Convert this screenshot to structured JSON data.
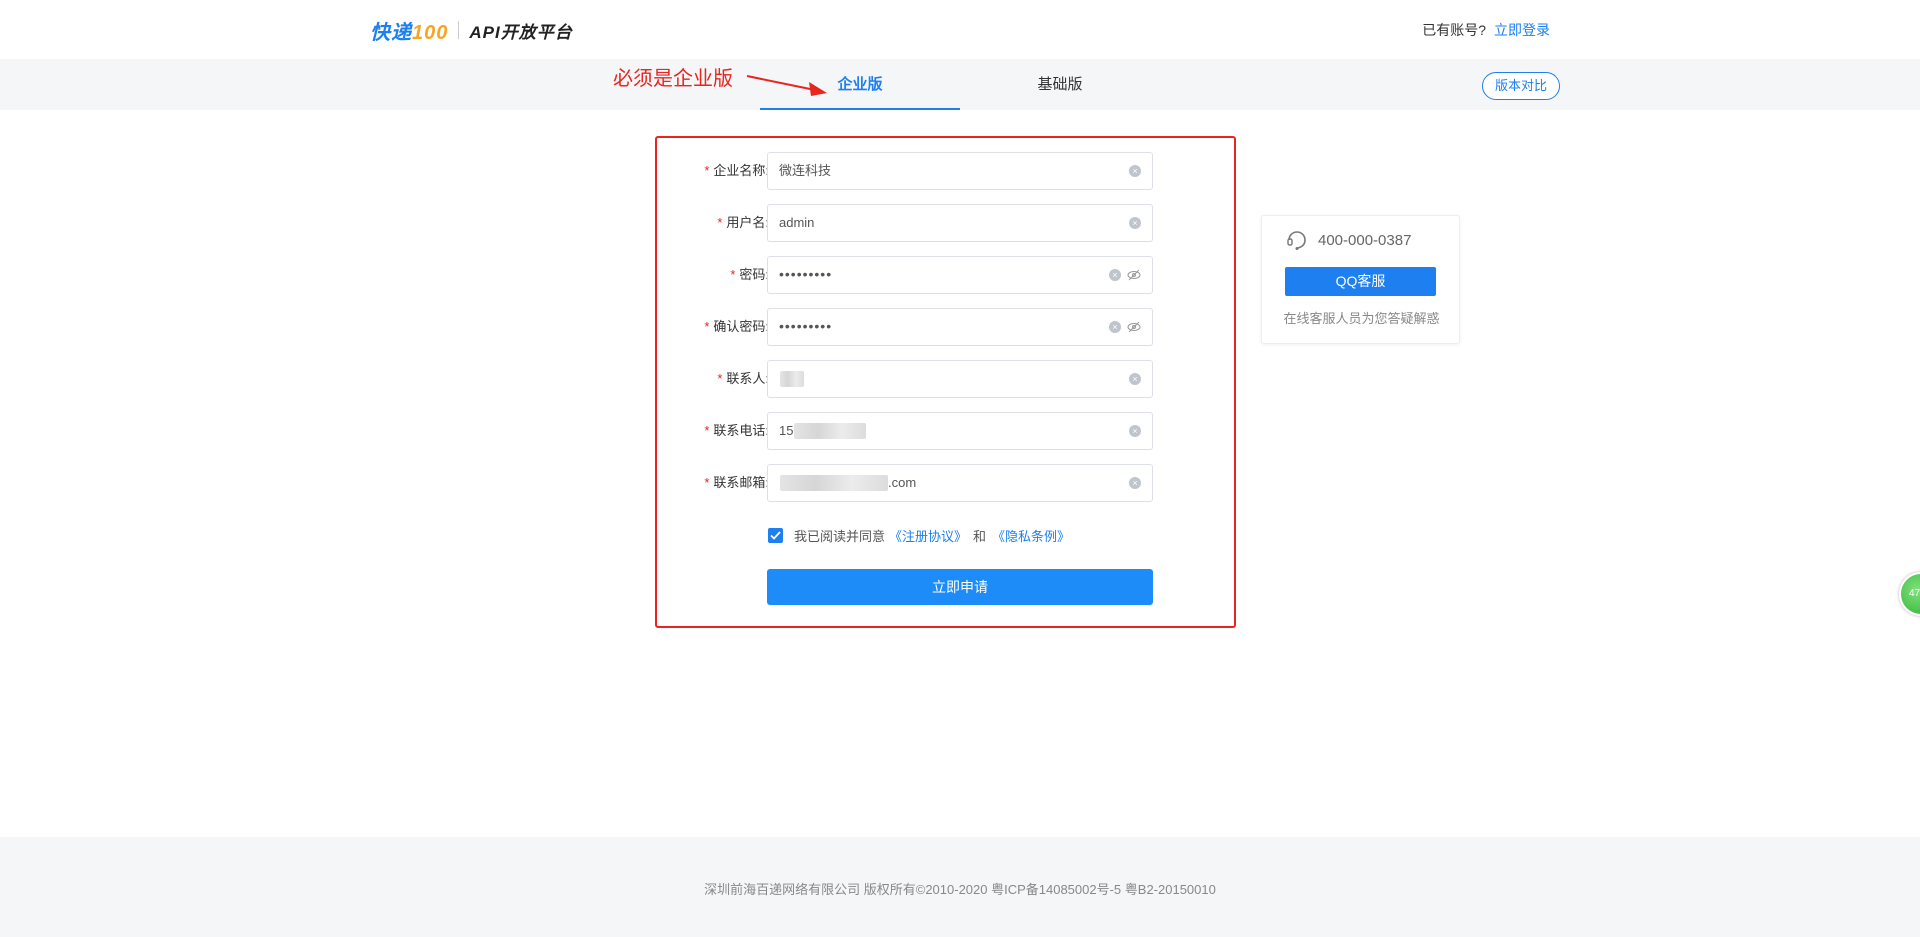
{
  "header": {
    "logo_brand": "快递",
    "logo_number": "100",
    "logo_platform": "API开放平台",
    "account_question": "已有账号?",
    "login_link": "立即登录"
  },
  "tabs": [
    {
      "label": "企业版",
      "active": true
    },
    {
      "label": "基础版",
      "active": false
    }
  ],
  "compare_button": "版本对比",
  "annotation": "必须是企业版",
  "form": {
    "fields": [
      {
        "label": "企业名称:",
        "value": "微连科技",
        "required": true
      },
      {
        "label": "用户名:",
        "value": "admin",
        "required": true
      },
      {
        "label": "密码:",
        "value": "•••••••••",
        "required": true,
        "password": true
      },
      {
        "label": "确认密码:",
        "value": "•••••••••",
        "required": true,
        "password": true
      },
      {
        "label": "联系人:",
        "value": "",
        "required": true
      },
      {
        "label": "联系电话:",
        "value": "15",
        "required": true
      },
      {
        "label": "联系邮箱:",
        "value": ".com",
        "required": true
      }
    ],
    "agree_text": "我已阅读并同意",
    "agree_link_1": "《注册协议》",
    "agree_and": "和",
    "agree_link_2": "《隐私条例》",
    "agree_checked": true,
    "submit": "立即申请"
  },
  "support": {
    "phone": "400-000-0387",
    "qq_button": "QQ客服",
    "note": "在线客服人员为您答疑解惑"
  },
  "float_badge": "47",
  "footer": {
    "text": "深圳前海百递网络有限公司 版权所有©2010-2020 粤ICP备14085002号-5 粤B2-20150010"
  },
  "colors": {
    "accent": "#1d7ff0",
    "annotation": "#e8251f",
    "required": "#e8251f"
  }
}
